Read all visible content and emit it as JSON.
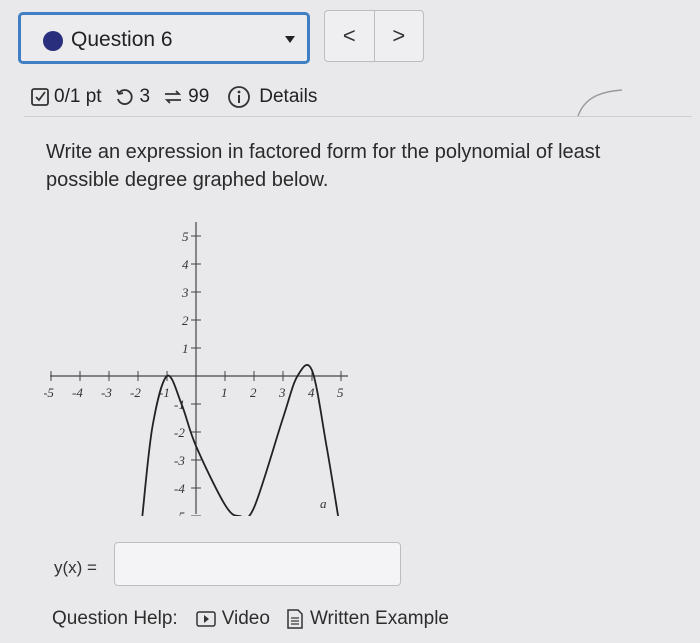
{
  "question_select": {
    "label": "Question 6",
    "status_color": "#2a2f7d"
  },
  "nav": {
    "prev_label": "<",
    "next_label": ">"
  },
  "meta": {
    "score": "0/1 pt",
    "tries_left": "3",
    "submissions": "99",
    "details_label": "Details"
  },
  "prompt": "Write an expression in factored form for the polynomial of least possible degree graphed below.",
  "chart_data": {
    "type": "line",
    "x_ticks": [
      "-5",
      "-4",
      "-3",
      "-2",
      "-1",
      "1",
      "2",
      "3",
      "4",
      "5"
    ],
    "y_ticks": [
      "5",
      "4",
      "3",
      "2",
      "1",
      "-1",
      "-2",
      "-3",
      "-4",
      "-5"
    ],
    "xlim": [
      -5,
      5
    ],
    "ylim": [
      -5,
      5
    ],
    "series": [
      {
        "x": [
          -1.85,
          -1.5,
          -1.0,
          -0.5,
          0.0,
          1.0,
          1.5,
          2.0,
          3.0,
          3.5,
          4.0,
          4.5,
          4.9
        ],
        "y": [
          -5.0,
          -1.8,
          0.0,
          -1.0,
          -2.5,
          -4.6,
          -5.0,
          -4.7,
          -1.5,
          0.0,
          0.2,
          -2.5,
          -5.0
        ]
      }
    ],
    "annotation": "a"
  },
  "answer": {
    "label": "y(x) =",
    "value": ""
  },
  "help": {
    "label": "Question Help:",
    "video_label": "Video",
    "written_example_label": "Written Example"
  }
}
